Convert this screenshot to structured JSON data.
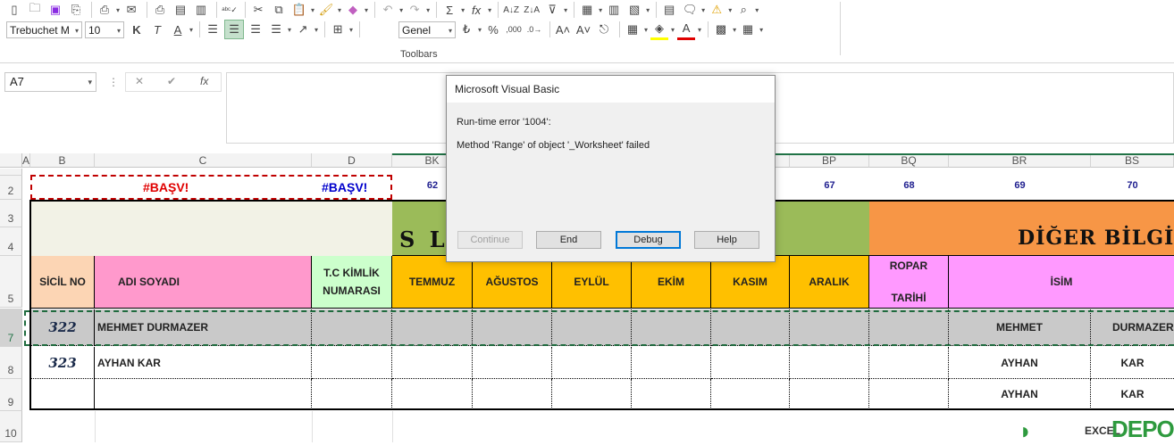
{
  "ribbon": {
    "font_name": "Trebuchet M",
    "font_size": "10",
    "number_format": "Genel",
    "group_label": "Toolbars",
    "bold": "K",
    "italic": "T",
    "underline": "A",
    "percent": "%",
    "sum_glyph": "Σ",
    "fx_glyph": "fx"
  },
  "formula_bar": {
    "name_box": "A7",
    "cancel_glyph": "✕",
    "enter_glyph": "✔",
    "fx_glyph": "fx",
    "formula_value": ""
  },
  "columns": [
    "A",
    "B",
    "C",
    "D",
    "BK",
    "BP",
    "BQ",
    "BR",
    "BS"
  ],
  "rows": [
    "2",
    "3",
    "4",
    "5",
    "7",
    "8",
    "9",
    "10"
  ],
  "sheet": {
    "basv_left": "#BAŞV!",
    "basv_right": "#BAŞV!",
    "num_62": "62",
    "num_67": "67",
    "num_68": "68",
    "num_69": "69",
    "num_70": "70",
    "banner_left": "S L A",
    "banner_right": "DİĞER BİLGİL",
    "headers": {
      "sicil": "SİCİL NO",
      "adi": "ADI SOYADI",
      "tc": "T.C KİMLİK NUMARASI",
      "temmuz": "TEMMUZ",
      "agustos": "AĞUSTOS",
      "eylul": "EYLÜL",
      "ekim": "EKİM",
      "kasim": "KASIM",
      "aralik": "ARALIK",
      "ropar1": "ROPAR",
      "ropar2": "TARİHİ",
      "isim": "İSİM"
    },
    "rows": [
      {
        "sicil": "322",
        "name": "MEHMET DURMAZER",
        "isim": "MEHMET",
        "soyad": "DURMAZER"
      },
      {
        "sicil": "323",
        "name": "AYHAN KAR",
        "isim": "AYHAN",
        "soyad": "KAR"
      },
      {
        "sicil": "",
        "name": "",
        "isim": "AYHAN",
        "soyad": "KAR"
      }
    ]
  },
  "dialog": {
    "title": "Microsoft Visual Basic",
    "line1": "Run-time error '1004':",
    "line2": "Method 'Range' of object '_Worksheet' failed",
    "btn_continue": "Continue",
    "btn_end": "End",
    "btn_debug": "Debug",
    "btn_help": "Help"
  },
  "watermark": "DEPO",
  "watermark_small": "EXCEL",
  "colors": {
    "green_banner": "#9bbb59",
    "orange_banner": "#f79646",
    "pink": "#ff99cc",
    "peach": "#fcd5b4",
    "lightgreen": "#ccffcc",
    "yellow": "#ffc000",
    "magenta_light": "#ff99ff",
    "selected_row": "#c9c9c9",
    "basv_red": "#e00000",
    "basv_blue": "#0000cc",
    "num_blue": "#1f1f8f"
  }
}
